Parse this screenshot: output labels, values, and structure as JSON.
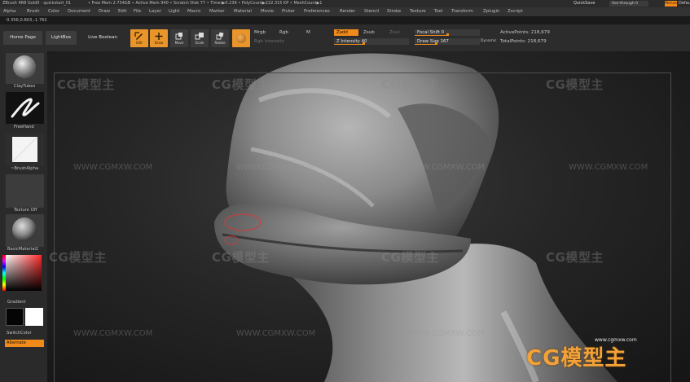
{
  "titlebar": {
    "app_title": "ZBrush 4R8 Gold5 · quickstart_01",
    "stats": "• Free Mem 2.734GB • Active Mem 940 • Scratch Disk 77 • Timer▶0.239 • PolyCount▶222.315 KP • MeshCount▶1",
    "quicksave": "QuickSave",
    "see_through": "See-through  0",
    "menus": "Menus",
    "default_script": "Default"
  },
  "menu": [
    "Alpha",
    "Brush",
    "Color",
    "Document",
    "Draw",
    "Edit",
    "File",
    "Layer",
    "Light",
    "Macro",
    "Marker",
    "Material",
    "Movie",
    "Picker",
    "Preferences",
    "Render",
    "Stencil",
    "Stroke",
    "Texture",
    "Tool",
    "Transform",
    "Zplugin",
    "Zscript"
  ],
  "coords": "0.356,0.803,-1.762",
  "toolbar": {
    "home_page": "Home Page",
    "lightbox": "LightBox",
    "live_boolean": "Live Boolean",
    "edit": "Edit",
    "draw": "Draw",
    "move": "Move",
    "scale": "Scale",
    "rotate": "Rotate",
    "mrgb": "Mrgb",
    "rgb": "Rgb",
    "m": "M",
    "rgb_intensity": "Rgb Intensity",
    "zadd": "Zadd",
    "zsub": "Zsub",
    "zcut": "Zcut",
    "z_intensity": "Z Intensity 40",
    "focal_shift": "Focal Shift 0",
    "draw_size": "Draw Size 167",
    "dynamic": "Dynamic",
    "active_points": "ActivePoints: 218,679",
    "total_points": "TotalPoints: 218,679",
    "z_intensity_level": 0.4,
    "focal_shift_level": 0.5,
    "draw_size_level": 0.33
  },
  "tray": {
    "brush": "ClayTubes",
    "stroke": "FreeHand",
    "alpha": "~BrushAlpha",
    "texture": "Texture Off",
    "material": "BasicMaterial2",
    "gradient": "Gradient",
    "switch_color": "SwitchColor",
    "alternate": "Alternate"
  },
  "watermarks": {
    "logo_text": "CG模型主",
    "url": "WWW.CGMXW.COM",
    "brand_url": "www.cgmxw.com"
  },
  "colors": {
    "accent": "#f08a1a",
    "panel": "#2c2c2c",
    "viewport": "#262626"
  }
}
